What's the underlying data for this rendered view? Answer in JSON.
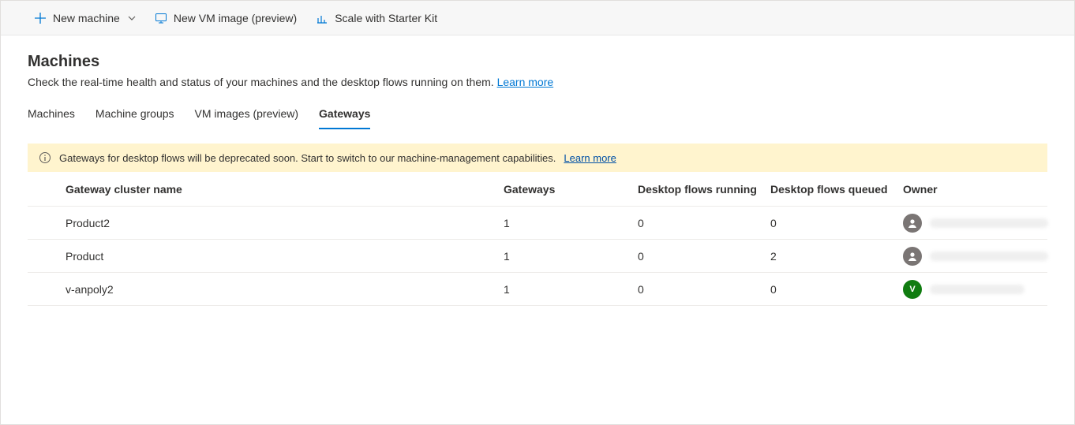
{
  "toolbar": {
    "new_machine": "New machine",
    "new_vm_image": "New VM image (preview)",
    "scale_kit": "Scale with Starter Kit"
  },
  "page": {
    "title": "Machines",
    "description": "Check the real-time health and status of your machines and the desktop flows running on them.",
    "learn_more": "Learn more"
  },
  "tabs": [
    "Machines",
    "Machine groups",
    "VM images (preview)",
    "Gateways"
  ],
  "active_tab": 3,
  "banner": {
    "text": "Gateways for desktop flows will be deprecated soon. Start to switch to our machine-management capabilities.",
    "link": "Learn more"
  },
  "table": {
    "headers": {
      "name": "Gateway cluster name",
      "gateways": "Gateways",
      "running": "Desktop flows running",
      "queued": "Desktop flows queued",
      "owner": "Owner"
    },
    "rows": [
      {
        "name": "Product2",
        "gateways": "1",
        "running": "0",
        "queued": "0",
        "owner_type": "person",
        "owner_initial": ""
      },
      {
        "name": "Product",
        "gateways": "1",
        "running": "0",
        "queued": "2",
        "owner_type": "person",
        "owner_initial": ""
      },
      {
        "name": "v-anpoly2",
        "gateways": "1",
        "running": "0",
        "queued": "0",
        "owner_type": "green",
        "owner_initial": "V"
      }
    ]
  }
}
